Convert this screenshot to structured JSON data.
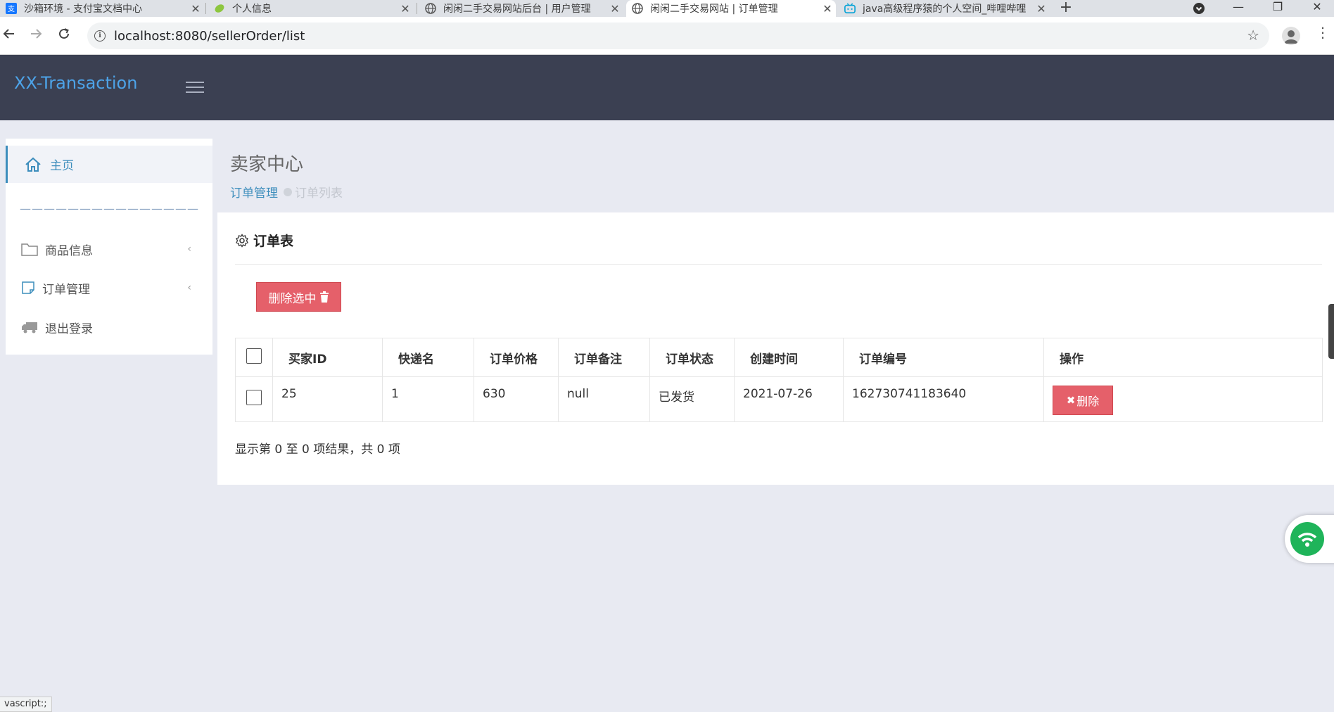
{
  "browser": {
    "tabs": [
      {
        "title": "沙箱环境 - 支付宝文档中心",
        "icon": "alipay-icon",
        "active": false
      },
      {
        "title": "个人信息",
        "icon": "leaf-icon",
        "active": false
      },
      {
        "title": "闲闲二手交易网站后台 | 用户管理",
        "icon": "globe-icon",
        "active": false
      },
      {
        "title": "闲闲二手交易网站 | 订单管理",
        "icon": "globe-icon",
        "active": true
      },
      {
        "title": "java高级程序猿的个人空间_哔哩哔哩",
        "icon": "bilibili-icon",
        "active": false
      }
    ],
    "url": "localhost:8080/sellerOrder/list",
    "status_text": "vascript:;"
  },
  "app": {
    "brand": "XX-Transaction",
    "accent_color": "#3c8dbc"
  },
  "sidebar": {
    "home_label": "主页",
    "divider": "———————————————",
    "items": [
      {
        "label": "商品信息",
        "icon": "folder-icon"
      },
      {
        "label": "订单管理",
        "icon": "note-icon"
      },
      {
        "label": "退出登录",
        "icon": "truck-icon"
      }
    ]
  },
  "content": {
    "page_title": "卖家中心",
    "breadcrumb": {
      "parent": "订单管理",
      "current": "订单列表"
    }
  },
  "panel": {
    "title": "订单表",
    "delete_selected_label": "删除选中",
    "columns": [
      "买家ID",
      "快递名",
      "订单价格",
      "订单备注",
      "订单状态",
      "创建时间",
      "订单编号",
      "操作"
    ],
    "rows": [
      {
        "buyer_id": "25",
        "courier": "1",
        "price": "630",
        "note": "null",
        "status": "已发货",
        "created": "2021-07-26",
        "order_no": "162730741183640",
        "delete_label": "删除"
      }
    ],
    "info_text": "显示第 0 至 0 项结果，共 0 项"
  }
}
